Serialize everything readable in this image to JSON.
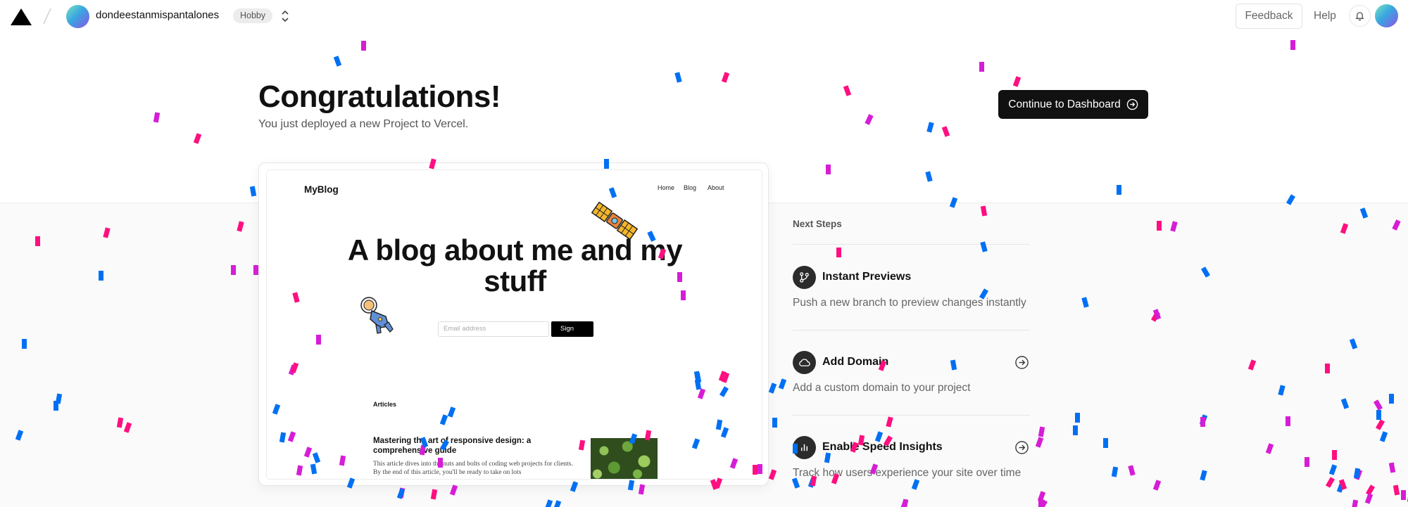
{
  "header": {
    "team_name": "dondeestanmispantalones",
    "plan_badge": "Hobby",
    "feedback_label": "Feedback",
    "help_label": "Help"
  },
  "hero": {
    "title": "Congratulations!",
    "subtitle": "You just deployed a new Project to Vercel.",
    "continue_label": "Continue to Dashboard"
  },
  "preview": {
    "brand": "MyBlog",
    "nav": [
      "Home",
      "Blog",
      "About"
    ],
    "headline": "A blog about me and my stuff",
    "email_placeholder": "Email address",
    "sign_label": "Sign",
    "articles_heading": "Articles",
    "article_title": "Mastering the art of responsive design: a comprehensive guide",
    "article_excerpt": "This article dives into the nuts and bolts of coding web projects for clients. By the end of this article, you'll be ready to take on lots"
  },
  "next_steps": {
    "heading": "Next Steps",
    "items": [
      {
        "title": "Instant Previews",
        "description": "Push a new branch to preview changes instantly",
        "icon": "git-branch-icon"
      },
      {
        "title": "Add Domain",
        "description": "Add a custom domain to your project",
        "icon": "cloud-icon"
      },
      {
        "title": "Enable Speed Insights",
        "description": "Track how users experience your site over time",
        "icon": "bar-chart-icon"
      }
    ]
  },
  "colors": {
    "confetti_pink": "#ff0f80",
    "confetti_blue": "#0070f3",
    "confetti_magenta": "#d61dd6",
    "button_dark": "#111111"
  }
}
